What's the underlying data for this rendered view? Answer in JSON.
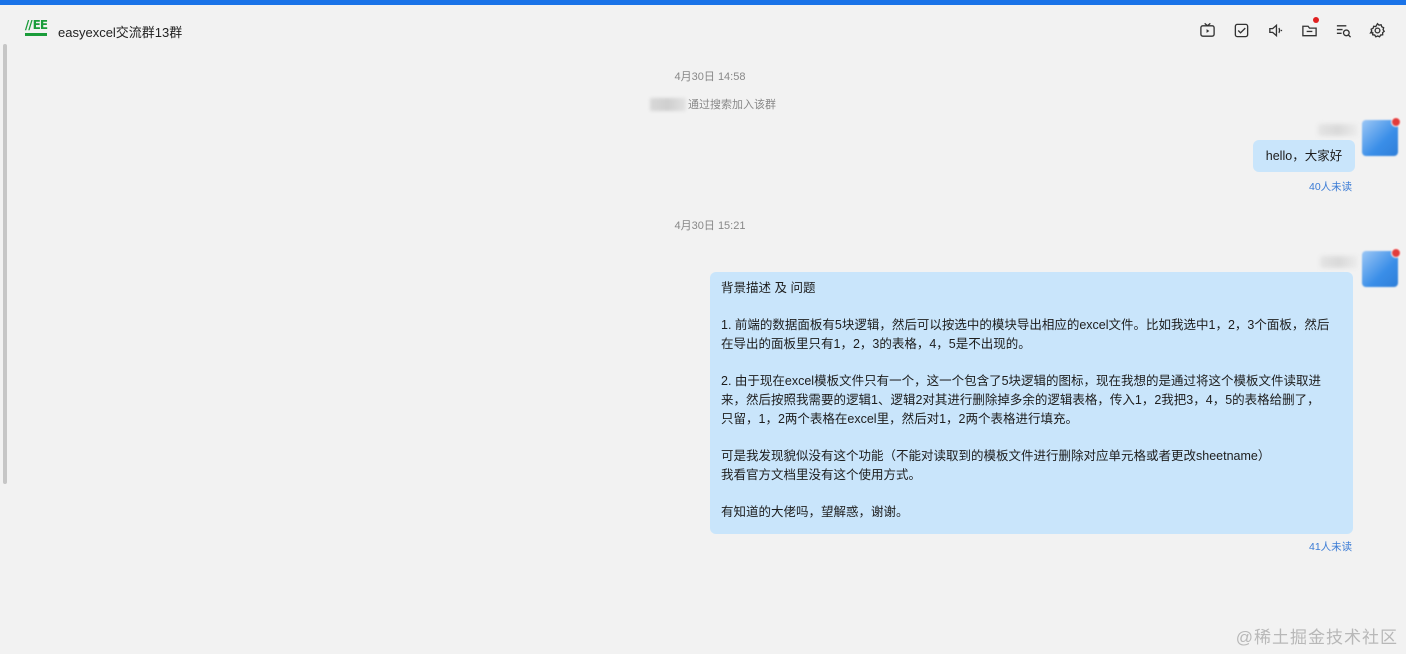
{
  "header": {
    "logo_text": "EE",
    "title": "easyexcel交流群13群",
    "tools": [
      {
        "icon": "tv-icon"
      },
      {
        "icon": "checkbox-icon"
      },
      {
        "icon": "speaker-icon"
      },
      {
        "icon": "folder-icon",
        "badge": true
      },
      {
        "icon": "search-list-icon"
      },
      {
        "icon": "gear-icon"
      }
    ]
  },
  "messages": {
    "time1": "4月30日 14:58",
    "system_suffix": "通过搜索加入该群",
    "msg1": {
      "text": "hello，大家好",
      "unread": "40人未读"
    },
    "time2": "4月30日 15:21",
    "msg2": {
      "lines": [
        "背景描述 及 问题",
        "",
        "1. 前端的数据面板有5块逻辑，然后可以按选中的模块导出相应的excel文件。比如我选中1，2，3个面板，然后",
        "在导出的面板里只有1，2，3的表格，4，5是不出现的。",
        "",
        "2. 由于现在excel模板文件只有一个，这一个包含了5块逻辑的图标，现在我想的是通过将这个模板文件读取进",
        "来，然后按照我需要的逻辑1、逻辑2对其进行删除掉多余的逻辑表格，传入1，2我把3，4，5的表格给删了，",
        "只留，1，2两个表格在excel里，然后对1，2两个表格进行填充。",
        "",
        "可是我发现貌似没有这个功能（不能对读取到的模板文件进行删除对应单元格或者更改sheetname）",
        "我看官方文档里没有这个使用方式。",
        "",
        "有知道的大佬吗，望解惑，谢谢。"
      ],
      "unread": "41人未读"
    }
  },
  "watermark": "@稀土掘金技术社区",
  "colors": {
    "accent": "#1a73e8",
    "bubble": "#c9e5fb",
    "unread": "#3a7bd5",
    "badge": "#e02020",
    "logo": "#1a9c3a"
  }
}
